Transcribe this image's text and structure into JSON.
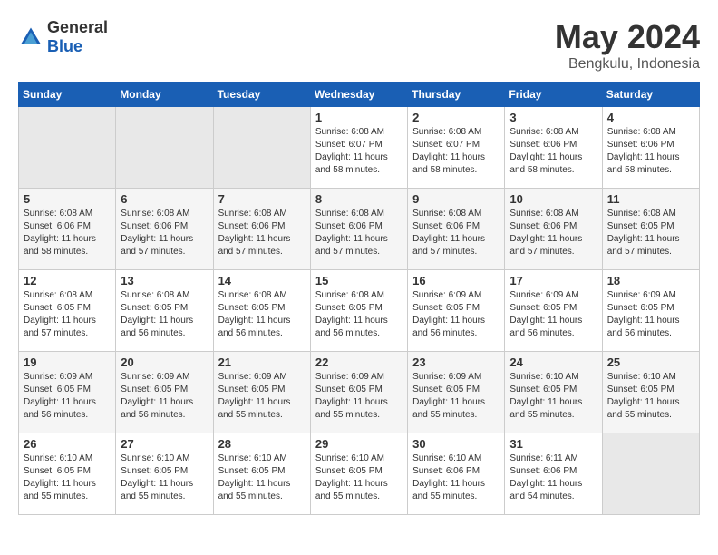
{
  "logo": {
    "general": "General",
    "blue": "Blue"
  },
  "title": {
    "month_year": "May 2024",
    "location": "Bengkulu, Indonesia"
  },
  "weekdays": [
    "Sunday",
    "Monday",
    "Tuesday",
    "Wednesday",
    "Thursday",
    "Friday",
    "Saturday"
  ],
  "weeks": [
    [
      {
        "day": "",
        "info": ""
      },
      {
        "day": "",
        "info": ""
      },
      {
        "day": "",
        "info": ""
      },
      {
        "day": "1",
        "info": "Sunrise: 6:08 AM\nSunset: 6:07 PM\nDaylight: 11 hours\nand 58 minutes."
      },
      {
        "day": "2",
        "info": "Sunrise: 6:08 AM\nSunset: 6:07 PM\nDaylight: 11 hours\nand 58 minutes."
      },
      {
        "day": "3",
        "info": "Sunrise: 6:08 AM\nSunset: 6:06 PM\nDaylight: 11 hours\nand 58 minutes."
      },
      {
        "day": "4",
        "info": "Sunrise: 6:08 AM\nSunset: 6:06 PM\nDaylight: 11 hours\nand 58 minutes."
      }
    ],
    [
      {
        "day": "5",
        "info": "Sunrise: 6:08 AM\nSunset: 6:06 PM\nDaylight: 11 hours\nand 58 minutes."
      },
      {
        "day": "6",
        "info": "Sunrise: 6:08 AM\nSunset: 6:06 PM\nDaylight: 11 hours\nand 57 minutes."
      },
      {
        "day": "7",
        "info": "Sunrise: 6:08 AM\nSunset: 6:06 PM\nDaylight: 11 hours\nand 57 minutes."
      },
      {
        "day": "8",
        "info": "Sunrise: 6:08 AM\nSunset: 6:06 PM\nDaylight: 11 hours\nand 57 minutes."
      },
      {
        "day": "9",
        "info": "Sunrise: 6:08 AM\nSunset: 6:06 PM\nDaylight: 11 hours\nand 57 minutes."
      },
      {
        "day": "10",
        "info": "Sunrise: 6:08 AM\nSunset: 6:06 PM\nDaylight: 11 hours\nand 57 minutes."
      },
      {
        "day": "11",
        "info": "Sunrise: 6:08 AM\nSunset: 6:05 PM\nDaylight: 11 hours\nand 57 minutes."
      }
    ],
    [
      {
        "day": "12",
        "info": "Sunrise: 6:08 AM\nSunset: 6:05 PM\nDaylight: 11 hours\nand 57 minutes."
      },
      {
        "day": "13",
        "info": "Sunrise: 6:08 AM\nSunset: 6:05 PM\nDaylight: 11 hours\nand 56 minutes."
      },
      {
        "day": "14",
        "info": "Sunrise: 6:08 AM\nSunset: 6:05 PM\nDaylight: 11 hours\nand 56 minutes."
      },
      {
        "day": "15",
        "info": "Sunrise: 6:08 AM\nSunset: 6:05 PM\nDaylight: 11 hours\nand 56 minutes."
      },
      {
        "day": "16",
        "info": "Sunrise: 6:09 AM\nSunset: 6:05 PM\nDaylight: 11 hours\nand 56 minutes."
      },
      {
        "day": "17",
        "info": "Sunrise: 6:09 AM\nSunset: 6:05 PM\nDaylight: 11 hours\nand 56 minutes."
      },
      {
        "day": "18",
        "info": "Sunrise: 6:09 AM\nSunset: 6:05 PM\nDaylight: 11 hours\nand 56 minutes."
      }
    ],
    [
      {
        "day": "19",
        "info": "Sunrise: 6:09 AM\nSunset: 6:05 PM\nDaylight: 11 hours\nand 56 minutes."
      },
      {
        "day": "20",
        "info": "Sunrise: 6:09 AM\nSunset: 6:05 PM\nDaylight: 11 hours\nand 56 minutes."
      },
      {
        "day": "21",
        "info": "Sunrise: 6:09 AM\nSunset: 6:05 PM\nDaylight: 11 hours\nand 55 minutes."
      },
      {
        "day": "22",
        "info": "Sunrise: 6:09 AM\nSunset: 6:05 PM\nDaylight: 11 hours\nand 55 minutes."
      },
      {
        "day": "23",
        "info": "Sunrise: 6:09 AM\nSunset: 6:05 PM\nDaylight: 11 hours\nand 55 minutes."
      },
      {
        "day": "24",
        "info": "Sunrise: 6:10 AM\nSunset: 6:05 PM\nDaylight: 11 hours\nand 55 minutes."
      },
      {
        "day": "25",
        "info": "Sunrise: 6:10 AM\nSunset: 6:05 PM\nDaylight: 11 hours\nand 55 minutes."
      }
    ],
    [
      {
        "day": "26",
        "info": "Sunrise: 6:10 AM\nSunset: 6:05 PM\nDaylight: 11 hours\nand 55 minutes."
      },
      {
        "day": "27",
        "info": "Sunrise: 6:10 AM\nSunset: 6:05 PM\nDaylight: 11 hours\nand 55 minutes."
      },
      {
        "day": "28",
        "info": "Sunrise: 6:10 AM\nSunset: 6:05 PM\nDaylight: 11 hours\nand 55 minutes."
      },
      {
        "day": "29",
        "info": "Sunrise: 6:10 AM\nSunset: 6:05 PM\nDaylight: 11 hours\nand 55 minutes."
      },
      {
        "day": "30",
        "info": "Sunrise: 6:10 AM\nSunset: 6:06 PM\nDaylight: 11 hours\nand 55 minutes."
      },
      {
        "day": "31",
        "info": "Sunrise: 6:11 AM\nSunset: 6:06 PM\nDaylight: 11 hours\nand 54 minutes."
      },
      {
        "day": "",
        "info": ""
      }
    ]
  ]
}
